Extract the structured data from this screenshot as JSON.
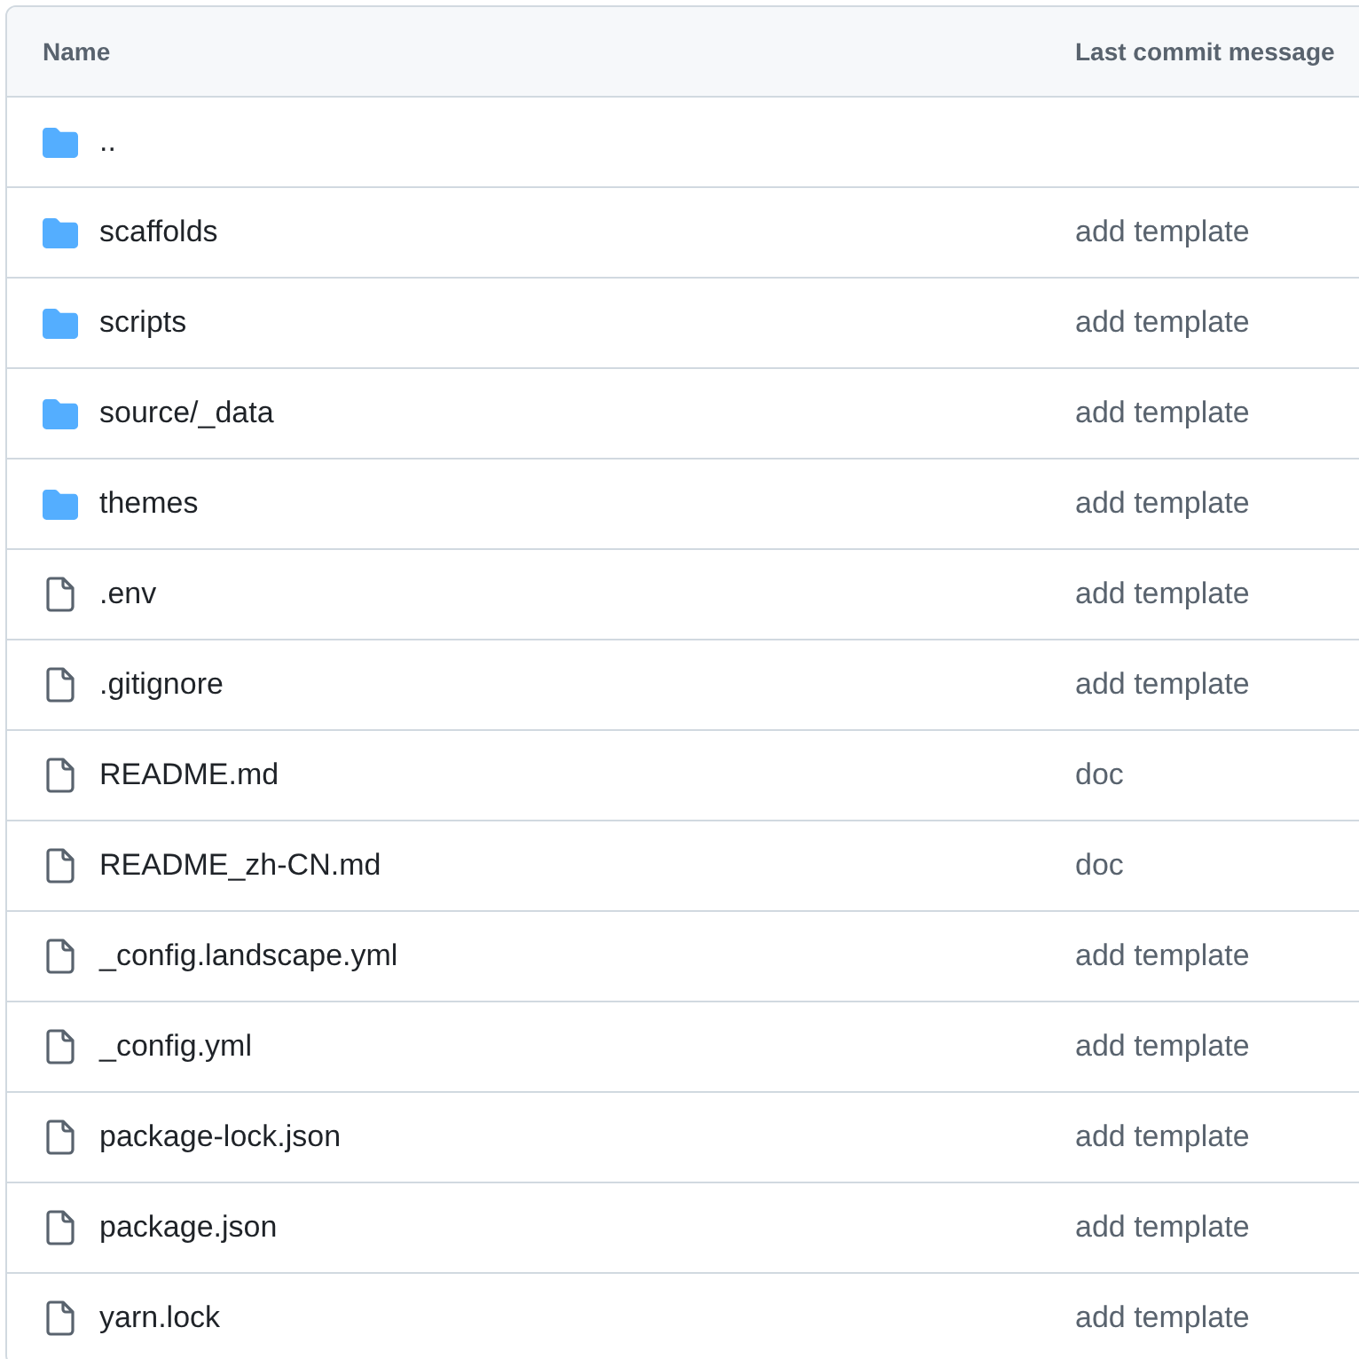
{
  "table": {
    "columns": [
      "Name",
      "Last commit message"
    ],
    "rows": [
      {
        "kind": "folder",
        "name": ".."
      },
      {
        "kind": "folder",
        "name": "scaffolds",
        "commit_message": "add template"
      },
      {
        "kind": "folder",
        "name": "scripts",
        "commit_message": "add template"
      },
      {
        "kind": "folder",
        "name": "source/_data",
        "commit_message": "add template"
      },
      {
        "kind": "folder",
        "name": "themes",
        "commit_message": "add template"
      },
      {
        "kind": "file",
        "name": ".env",
        "commit_message": "add template"
      },
      {
        "kind": "file",
        "name": ".gitignore",
        "commit_message": "add template"
      },
      {
        "kind": "file",
        "name": "README.md",
        "commit_message": "doc"
      },
      {
        "kind": "file",
        "name": "README_zh-CN.md",
        "commit_message": "doc"
      },
      {
        "kind": "file",
        "name": "_config.landscape.yml",
        "commit_message": "add template"
      },
      {
        "kind": "file",
        "name": "_config.yml",
        "commit_message": "add template"
      },
      {
        "kind": "file",
        "name": "package-lock.json",
        "commit_message": "add template"
      },
      {
        "kind": "file",
        "name": "package.json",
        "commit_message": "add template"
      },
      {
        "kind": "file",
        "name": "yarn.lock",
        "commit_message": "add template"
      }
    ]
  }
}
